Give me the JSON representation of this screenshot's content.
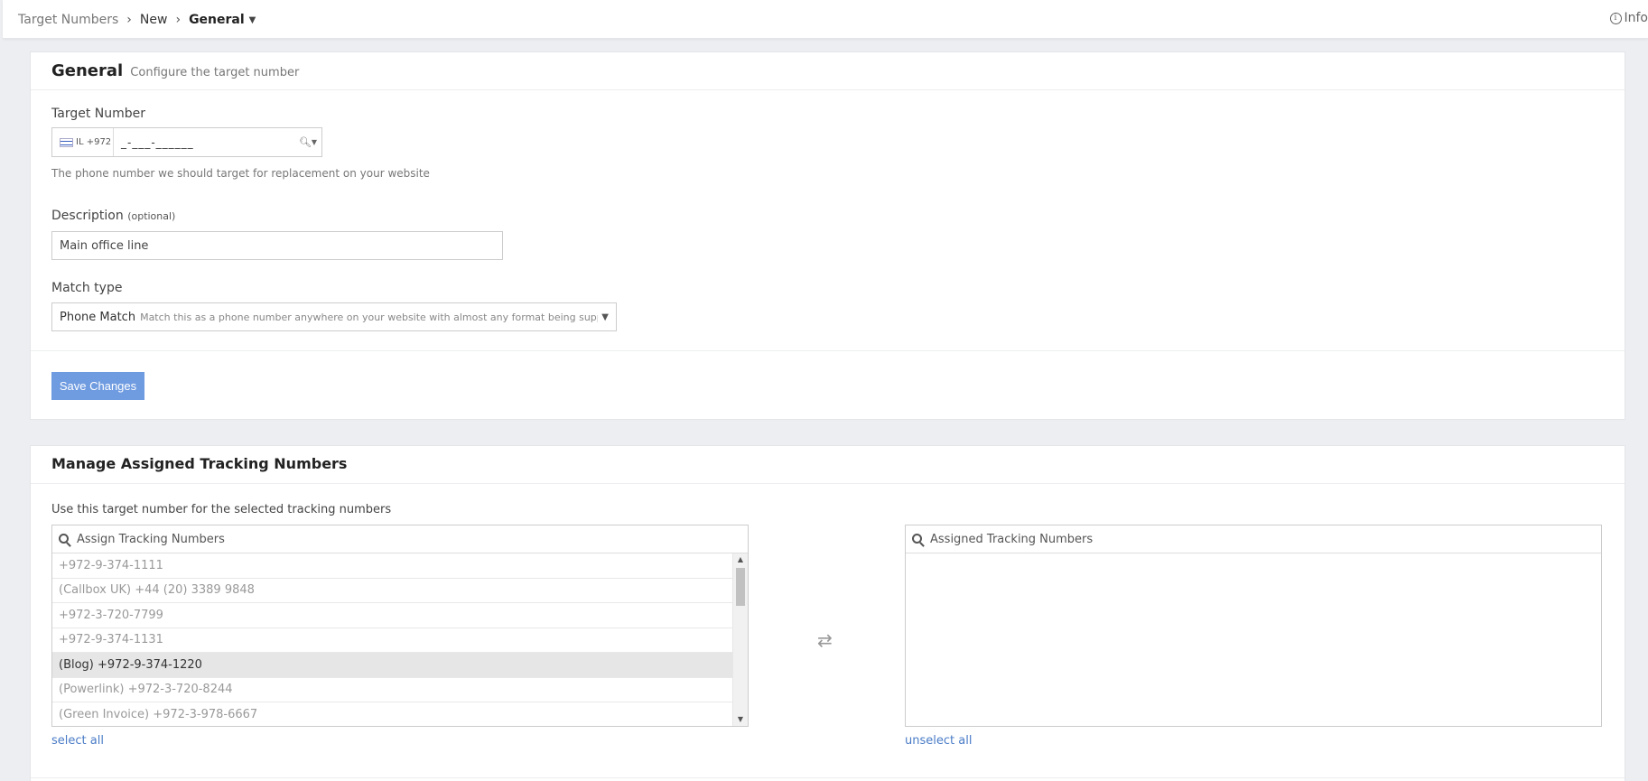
{
  "breadcrumb": {
    "items": [
      "Target Numbers",
      "New",
      "General"
    ]
  },
  "topbar": {
    "info_label": "Info"
  },
  "general": {
    "title": "General",
    "subtitle": "Configure the target number",
    "target_number_label": "Target Number",
    "country": "IL +972",
    "phone_value": "_-___-______",
    "phone_help": "The phone number we should target for replacement on your website",
    "description_label": "Description",
    "description_optional": "(optional)",
    "description_value": "Main office line",
    "match_type_label": "Match type",
    "match_type_value": "Phone Match",
    "match_type_desc": "Match this as a phone number anywhere on your website with almost any format being supported",
    "save_label": "Save Changes"
  },
  "manage": {
    "title": "Manage Assigned Tracking Numbers",
    "description": "Use this target number for the selected tracking numbers",
    "assign_placeholder": "Assign Tracking Numbers",
    "assigned_placeholder": "Assigned Tracking Numbers",
    "available": [
      "+972-9-374-1111",
      "(Callbox UK) +44 (20) 3389 9848",
      "+972-3-720-7799",
      "+972-9-374-1131",
      "(Blog) +972-9-374-1220",
      "(Powerlink) +972-3-720-8244",
      "(Green Invoice) +972-3-978-6667"
    ],
    "selected_index": 4,
    "select_all_label": "select all",
    "unselect_all_label": "unselect all"
  },
  "colors": {
    "primary_button": "#6f9be0",
    "link": "#4a7cc7",
    "background": "#eceef1"
  },
  "icons": {
    "swap": "swap-arrows-icon",
    "search": "search-icon",
    "info": "info-icon"
  }
}
